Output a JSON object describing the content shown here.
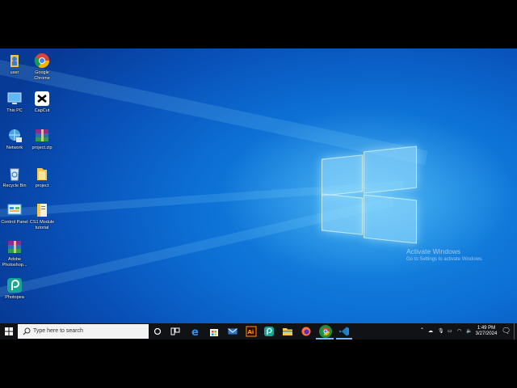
{
  "desktop": {
    "icons": [
      {
        "label": "user",
        "icon": "user-folder-icon"
      },
      {
        "label": "Google Chrome",
        "icon": "chrome-icon"
      },
      {
        "label": "This PC",
        "icon": "this-pc-icon"
      },
      {
        "label": "CapCut",
        "icon": "capcut-icon"
      },
      {
        "label": "Network",
        "icon": "network-icon"
      },
      {
        "label": "project.zip",
        "icon": "winrar-archive-icon"
      },
      {
        "label": "Recycle Bin",
        "icon": "recycle-bin-icon"
      },
      {
        "label": "project",
        "icon": "folder-icon"
      },
      {
        "label": "Control Panel",
        "icon": "control-panel-icon"
      },
      {
        "label": "CS1 Module tutorial",
        "icon": "document-icon"
      },
      {
        "label": "Adobe Photoshop...",
        "icon": "winrar-icon"
      },
      {
        "label": "Photopea",
        "icon": "photopea-icon"
      }
    ]
  },
  "watermark": {
    "line1": "Activate Windows",
    "line2": "Go to Settings to activate Windows."
  },
  "taskbar": {
    "search_placeholder": "Type here to search",
    "pinned": [
      "cortana-icon",
      "task-view-icon",
      "edge-icon",
      "store-icon",
      "mail-icon",
      "illustrator-icon",
      "photopea-icon",
      "file-explorer-icon",
      "firefox-icon",
      "chrome-icon",
      "vscode-icon"
    ],
    "clock_time": "1:49 PM",
    "clock_date": "3/27/2024"
  },
  "colors": {
    "desktop_blue": "#0c6fd4",
    "taskbar": "#101216",
    "highlight_green": "#1a8f3a"
  }
}
